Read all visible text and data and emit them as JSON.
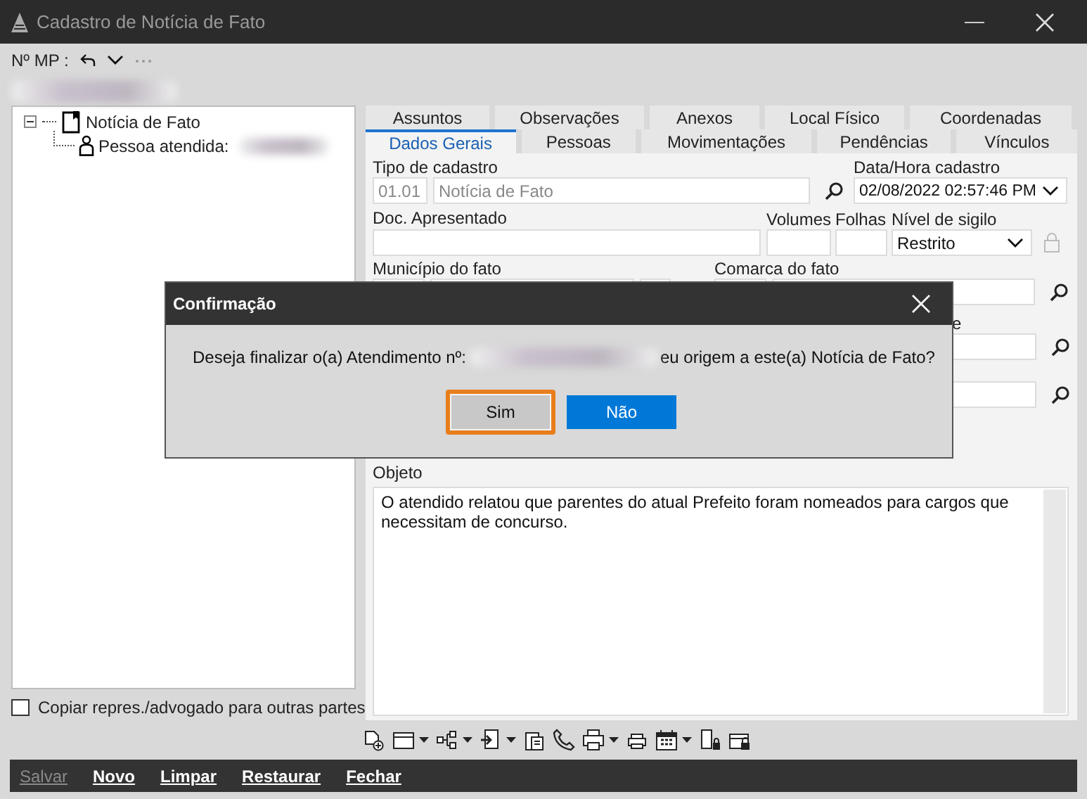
{
  "window": {
    "title": "Cadastro de Notícia de Fato"
  },
  "header": {
    "mp_label": "Nº MP :"
  },
  "tree": [
    {
      "label": "Notícia de Fato",
      "expanded": true,
      "children": [
        {
          "label": "Pessoa atendida:"
        }
      ]
    }
  ],
  "tabs_back": [
    {
      "label": "Assuntos",
      "selected": false
    },
    {
      "label": "Observações",
      "selected": false
    },
    {
      "label": "Anexos",
      "selected": false
    },
    {
      "label": "Local Físico",
      "selected": false
    },
    {
      "label": "Coordenadas",
      "selected": false
    }
  ],
  "tabs_front": [
    {
      "label": "Dados Gerais",
      "selected": true
    },
    {
      "label": "Pessoas",
      "selected": false
    },
    {
      "label": "Movimentações",
      "selected": false
    },
    {
      "label": "Pendências",
      "selected": false
    },
    {
      "label": "Vínculos",
      "selected": false
    }
  ],
  "form": {
    "tipo_label": "Tipo de cadastro",
    "tipo_code": "01.01",
    "tipo_name": "Notícia de Fato",
    "data_label": "Data/Hora cadastro",
    "data_value": "02/08/2022 02:57:46 PM",
    "doc_label": "Doc. Apresentado",
    "volumes_label": "Volumes",
    "folhas_label": "Folhas",
    "sigilo_label": "Nível de sigilo",
    "sigilo_value": "Restrito",
    "municipio_label": "Município do fato",
    "comarca_label": "Comarca do fato",
    "hidden_label_tail": "e",
    "objeto_label": "Objeto",
    "objeto_value": "O atendido relatou que parentes do atual Prefeito foram nomeados para cargos que necessitam de concurso."
  },
  "copy_checkbox": {
    "label": "Copiar repres./advogado para outras partes",
    "checked": false
  },
  "actions": [
    {
      "label": "Salvar",
      "disabled": true
    },
    {
      "label": "Novo",
      "disabled": false
    },
    {
      "label": "Limpar",
      "disabled": false
    },
    {
      "label": "Restaurar",
      "disabled": false
    },
    {
      "label": "Fechar",
      "disabled": false
    }
  ],
  "dialog": {
    "title": "Confirmação",
    "message_start": "Deseja finalizar o(a) Atendimento nº:",
    "message_end": "eu origem a este(a) Notícia de Fato?",
    "buttons": [
      {
        "label": "Sim",
        "kind": "default",
        "focused": true
      },
      {
        "label": "Não",
        "kind": "primary",
        "focused": false
      }
    ]
  }
}
